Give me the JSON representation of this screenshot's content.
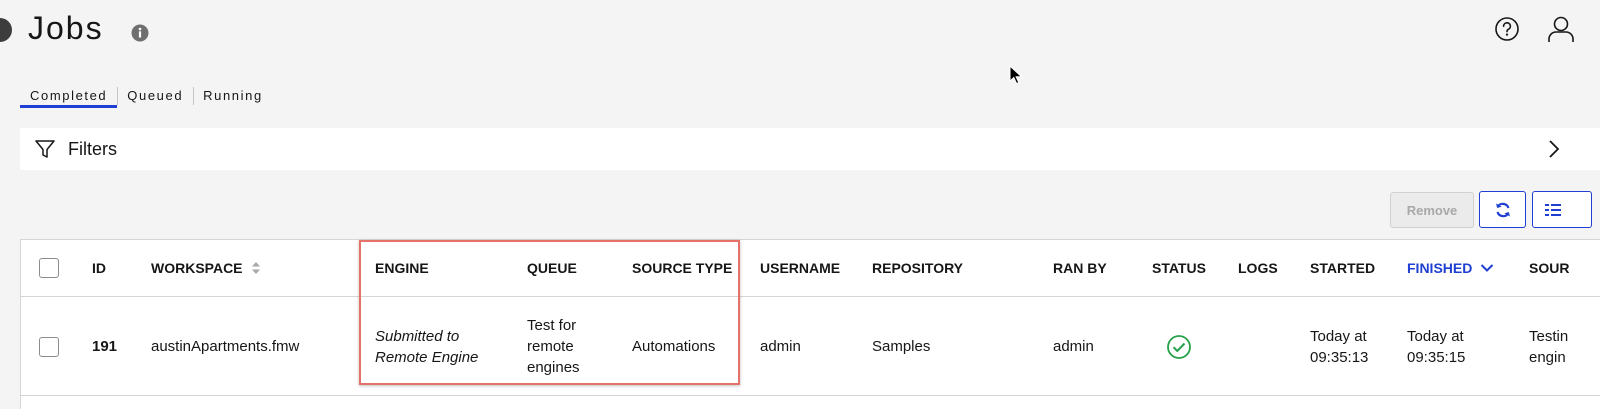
{
  "header": {
    "title": "Jobs",
    "icons": {
      "info": "info-icon",
      "help": "help-icon",
      "user": "user-icon",
      "back": "back-button"
    }
  },
  "tabs": [
    {
      "label": "Completed",
      "active": true
    },
    {
      "label": "Queued",
      "active": false
    },
    {
      "label": "Running",
      "active": false
    }
  ],
  "filters": {
    "label": "Filters",
    "icon": "filter-icon",
    "expand_icon": "chevron-right-icon"
  },
  "toolbar": {
    "remove_label": "Remove",
    "refresh_icon": "refresh-icon",
    "columns_icon": "columns-icon"
  },
  "table": {
    "columns": [
      "ID",
      "WORKSPACE",
      "ENGINE",
      "QUEUE",
      "SOURCE TYPE",
      "USERNAME",
      "REPOSITORY",
      "RAN BY",
      "STATUS",
      "LOGS",
      "STARTED",
      "FINISHED",
      "SOUR"
    ],
    "rows": [
      {
        "id": "191",
        "workspace": "austinApartments.fmw",
        "engine_line1": "Submitted to",
        "engine_line2": "Remote Engine",
        "queue_line1": "Test for",
        "queue_line2": "remote",
        "queue_line3": "engines",
        "source_type": "Automations",
        "username": "admin",
        "repository": "Samples",
        "ran_by": "admin",
        "status": "success-check-icon",
        "logs": "",
        "started_line1": "Today at",
        "started_line2": "09:35:13",
        "finished_line1": "Today at",
        "finished_line2": "09:35:15",
        "source_line1": "Testin",
        "source_line2": "engin"
      }
    ]
  },
  "colors": {
    "accent": "#1f3fd2",
    "success": "#24a148",
    "highlight": "#e5726a",
    "background": "#f4f4f4"
  }
}
